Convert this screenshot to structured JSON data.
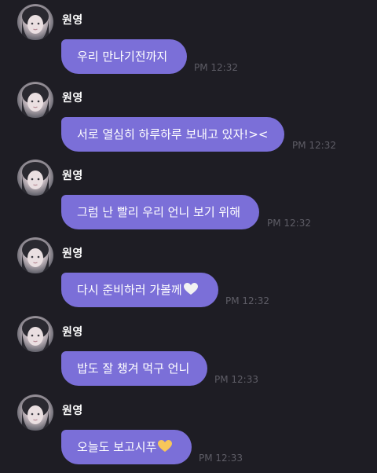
{
  "sender": {
    "name": "원영"
  },
  "colors": {
    "background": "#1e1d24",
    "bubble": "#7b6fd8",
    "time": "#5e5d66",
    "heart_white": "#f2f2f2",
    "heart_yellow": "#f7c65a"
  },
  "messages": [
    {
      "text": "우리 만나기전까지",
      "time": "PM 12:32",
      "emoji": ""
    },
    {
      "text": "서로 열심히 하루하루 보내고 있자!><",
      "time": "PM 12:32",
      "emoji": ""
    },
    {
      "text": "그럼 난 빨리 우리 언니 보기 위해",
      "time": "PM 12:32",
      "emoji": ""
    },
    {
      "text": "다시 준비하러 가볼께",
      "time": "PM 12:32",
      "emoji": "white-heart"
    },
    {
      "text": "밥도 잘 챙겨 먹구 언니",
      "time": "PM 12:33",
      "emoji": ""
    },
    {
      "text": "오늘도 보고시푸",
      "time": "PM 12:33",
      "emoji": "yellow-heart"
    }
  ]
}
